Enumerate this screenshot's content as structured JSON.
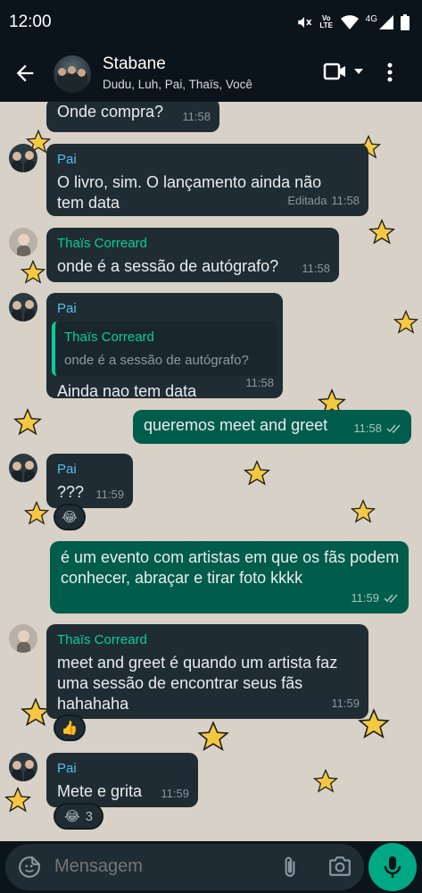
{
  "status_bar": {
    "time": "12:00",
    "network": "4G",
    "volte": "Vo LTE"
  },
  "header": {
    "group_name": "Stabane",
    "members": "Dudu, Luh, Pai, Thaïs, Você"
  },
  "messages": [
    {
      "type": "in",
      "text": "Onde compra?",
      "time": "11:58"
    },
    {
      "type": "in",
      "sender": "Pai",
      "text": "O livro, sim. O lançamento ainda não tem data",
      "edited": "Editada",
      "time": "11:58"
    },
    {
      "type": "in",
      "sender": "Thaïs Correard",
      "text": "onde é a sessão de autógrafo?",
      "time": "11:58"
    },
    {
      "type": "in",
      "sender": "Pai",
      "quote_sender": "Thaïs Correard",
      "quote_text": "onde é a sessão de autógrafo?",
      "text": "Ainda nao tem data",
      "time": "11:58"
    },
    {
      "type": "out",
      "text": "queremos meet and greet",
      "time": "11:58"
    },
    {
      "type": "in",
      "sender": "Pai",
      "text": "???",
      "time": "11:59",
      "reaction": "😂"
    },
    {
      "type": "out",
      "text": "é um evento com artistas em que os fãs podem conhecer, abraçar e tirar foto kkkk",
      "time": "11:59"
    },
    {
      "type": "in",
      "sender": "Thaïs Correard",
      "text": "meet and greet é quando um artista faz uma sessão de encontrar seus fãs hahahaha",
      "time": "11:59",
      "reaction": "👍"
    },
    {
      "type": "in",
      "sender": "Pai",
      "text": "Mete e grita",
      "time": "11:59",
      "reaction": "😂",
      "reaction_count": "3"
    }
  ],
  "input": {
    "placeholder": "Mensagem"
  },
  "colors": {
    "incoming": "#202c33",
    "outgoing": "#005c4b",
    "accent": "#00a884",
    "wallpaper": "#d7d1c7"
  }
}
